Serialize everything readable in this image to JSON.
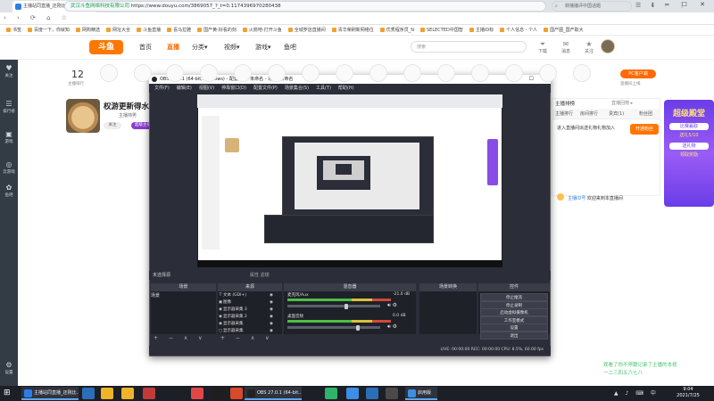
{
  "browser": {
    "tab_title": "主播站同直播_还刚比直播_斗鱼直...",
    "new_tab": "+",
    "window_controls": "─ ☐ ✕",
    "nav_glyphs": "‹ › ⟳ ⌂ ☆",
    "site_label": "武汉斗鱼网络科技有限公司",
    "url": "https://www.douyu.com/3869057_?_t=0.1174396970280438",
    "search_text": "转播播评中国话题",
    "ext_glyphs": "☰ ⬇ ✂ ⋮",
    "bookmarks": [
      "书签",
      "百度一下，你就知",
      "网购精选",
      "网址大全",
      "斗鱼直播",
      "喜马拉雅",
      "国产黄-好看的刻",
      "火箭吧-打开斗鱼",
      "全城罗店直播间",
      "青华荣刷新网络位",
      "优秀程序员_N",
      "SELECTED中国智",
      "主播ID标",
      "个人信息 - 个人",
      "国产图_国产取大"
    ]
  },
  "site": {
    "logo": "斗鱼",
    "nav": [
      "首页",
      "直播",
      "分类▾",
      "视频▾",
      "游戏▾",
      "鱼吧"
    ],
    "search_placeholder": "搜索",
    "icons": [
      {
        "glyph": "⏷",
        "label": "下载"
      },
      {
        "glyph": "✉",
        "label": "消息"
      },
      {
        "glyph": "★",
        "label": "关注"
      },
      {
        "glyph": "◷",
        "label": "历史"
      },
      {
        "glyph": "✚",
        "label": "开播"
      }
    ]
  },
  "left_sidebar": [
    {
      "glyph": "♥",
      "label": "关注"
    },
    {
      "glyph": "☰",
      "label": "排行榜"
    },
    {
      "glyph": "▣",
      "label": "游戏"
    },
    {
      "glyph": "◎",
      "label": "云游戏"
    },
    {
      "glyph": "✿",
      "label": "鱼吧"
    },
    {
      "glyph": "⚙",
      "label": "设置"
    }
  ],
  "rank": {
    "number": "12",
    "label": "主播排行"
  },
  "pc_badge": "PC客户端",
  "pc_sub": "直播间上线",
  "streamer": {
    "title": "权游更新得水日",
    "sub": "主播帅男",
    "follow": "关注",
    "tag": "超级主播"
  },
  "right_panel": {
    "title": "主播排榜",
    "top": "直播回榜 ▸",
    "tabs": [
      "主播排行",
      "房间排行",
      "贵宾(1)",
      "粉丝团"
    ],
    "note": "进入直播间派送礼物礼物加入",
    "gift_btn": "开通粉丝",
    "msg_user": "主播ID号",
    "msg_text": "欢迎来到本直播间"
  },
  "promo": {
    "big": "超级殿堂",
    "line1": "比赛赢取",
    "tag1": "送礼5/10",
    "line2": "送礼物",
    "tag2": "领取奖励"
  },
  "watermark": "观看了你不停跟记录了主播的本视\n一二三四五六七八",
  "obs": {
    "title": "OBS 27.0.1 (64-bit, windows) - 配置文件: 未命名 - 场景: 未命名",
    "window_controls": "─ ☐ ✕",
    "menu": [
      "文件(F)",
      "编辑(E)",
      "视图(V)",
      "停靠窗口(D)",
      "配置文件(P)",
      "场景集合(S)",
      "工具(T)",
      "帮助(H)"
    ],
    "dock_header": "未选择源",
    "dock_ctrl": "属性  滤镜",
    "docks": [
      "场景",
      "来源",
      "混音器",
      "场景转换",
      "控件"
    ],
    "scene": "场景",
    "sources": [
      {
        "icon": "T",
        "name": "文本 (GDI+)"
      },
      {
        "icon": "▣",
        "name": "图像"
      },
      {
        "icon": "◉",
        "name": "显示器采集 3"
      },
      {
        "icon": "◉",
        "name": "显示器采集 2"
      },
      {
        "icon": "◉",
        "name": "显示器采集"
      },
      {
        "icon": "▢",
        "name": "显示器采集"
      }
    ],
    "mixer": [
      {
        "name": "麦克风/Aux",
        "db": "-21.0 dB",
        "level": 0.62
      },
      {
        "name": "桌面音频",
        "db": "0.0 dB",
        "level": 0.74
      }
    ],
    "transition_type": "淡出",
    "transition_dur_label": "时长",
    "transition_dur": "300 ms",
    "controls": [
      "停止推流",
      "停止录制",
      "启动虚拟摄像机",
      "工作室模式",
      "设置",
      "退出"
    ],
    "status": "LIVE: 00:00:00    REC: 00:00:00    CPU: 8.5%, 60.00 fps"
  },
  "taskbar": {
    "start": "⊞",
    "windows": [
      {
        "label": "主播站同直播_还刚比...",
        "color": "#2b7de9"
      },
      {
        "label": "OBS 27.0.1 (64-bit...",
        "color": "#222222"
      },
      {
        "label": "启用版",
        "color": "#3d8ee6"
      }
    ],
    "tray": "▲ ♪ ⌨ 中",
    "time": "9:04",
    "date": "2021/7/25"
  },
  "colors": {
    "accent": "#ff7700",
    "obs_bg": "#2b2e38",
    "taskbar": "#1c1f26"
  }
}
